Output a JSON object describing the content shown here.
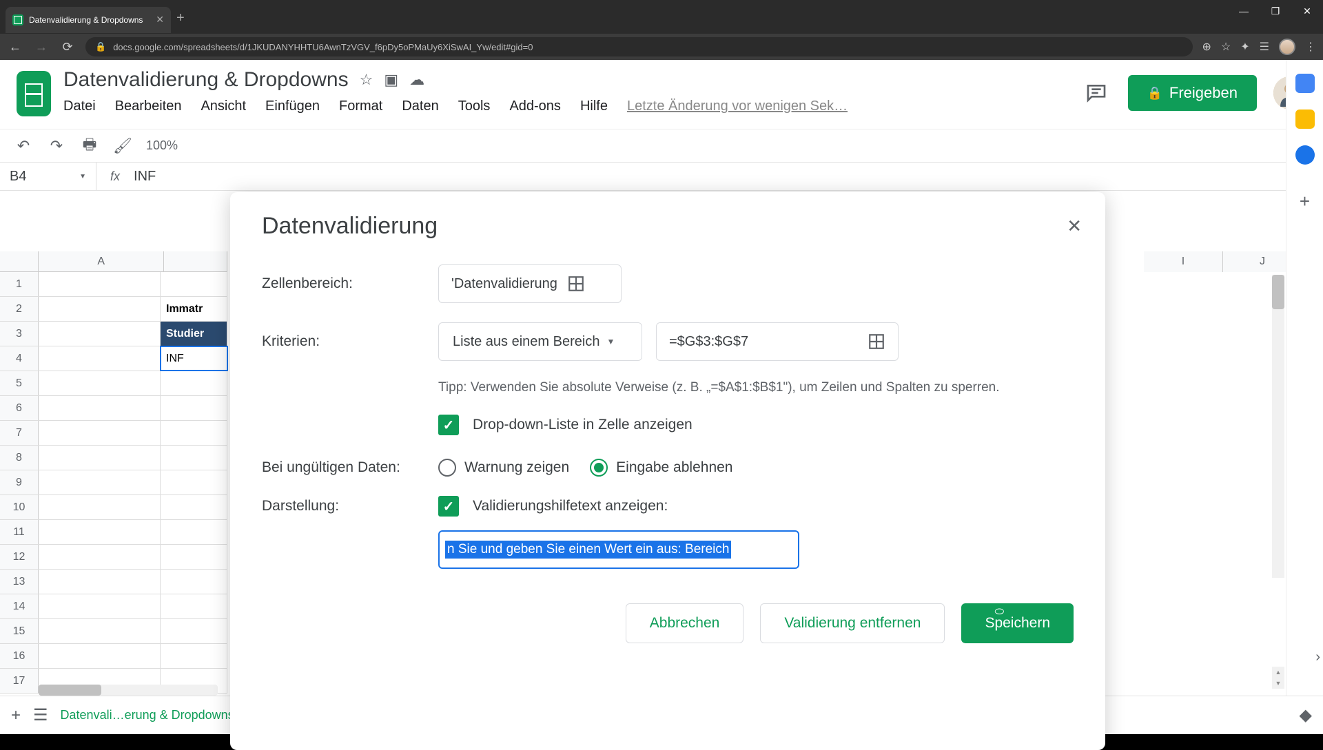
{
  "browser": {
    "tab_title": "Datenvalidierung & Dropdowns",
    "url": "docs.google.com/spreadsheets/d/1JKUDANYHHTU6AwnTzVGV_f6pDy5oPMaUy6XiSwAI_Yw/edit#gid=0"
  },
  "app": {
    "doc_title": "Datenvalidierung & Dropdowns",
    "menu": [
      "Datei",
      "Bearbeiten",
      "Ansicht",
      "Einfügen",
      "Format",
      "Daten",
      "Tools",
      "Add-ons",
      "Hilfe"
    ],
    "last_edit": "Letzte Änderung vor wenigen Sek…",
    "share_label": "Freigeben"
  },
  "toolbar": {
    "zoom": "100%"
  },
  "formula": {
    "cell_ref": "B4",
    "value": "INF"
  },
  "grid": {
    "col_headers": [
      "A"
    ],
    "right_cols": [
      "I",
      "J"
    ],
    "rows": [
      {
        "n": "1",
        "a": ""
      },
      {
        "n": "2",
        "a": "Immatr"
      },
      {
        "n": "3",
        "a": "Studier"
      },
      {
        "n": "4",
        "a": "INF"
      },
      {
        "n": "5",
        "a": ""
      },
      {
        "n": "6",
        "a": ""
      },
      {
        "n": "7",
        "a": ""
      },
      {
        "n": "8",
        "a": ""
      },
      {
        "n": "9",
        "a": ""
      },
      {
        "n": "10",
        "a": ""
      },
      {
        "n": "11",
        "a": ""
      },
      {
        "n": "12",
        "a": ""
      },
      {
        "n": "13",
        "a": ""
      },
      {
        "n": "14",
        "a": ""
      },
      {
        "n": "15",
        "a": ""
      },
      {
        "n": "16",
        "a": ""
      },
      {
        "n": "17",
        "a": ""
      }
    ]
  },
  "sheet_tab": "Datenvali…erung & Dropdowns",
  "dialog": {
    "title": "Datenvalidierung",
    "labels": {
      "range": "Zellenbereich:",
      "criteria": "Kriterien:",
      "invalid": "Bei ungültigen Daten:",
      "appearance": "Darstellung:"
    },
    "range_value": "'Datenvalidierung",
    "criteria_type": "Liste aus einem Bereich",
    "criteria_range": "=$G$3:$G$7",
    "tip": "Tipp: Verwenden Sie absolute Verweise (z. B. „=$A$1:$B$1\"), um Zeilen und Spalten zu sperren.",
    "show_dropdown": "Drop-down-Liste in Zelle anzeigen",
    "radio_warn": "Warnung zeigen",
    "radio_reject": "Eingabe ablehnen",
    "show_help": "Validierungshilfetext anzeigen:",
    "help_text": "n Sie und geben Sie einen Wert ein aus: Bereich",
    "actions": {
      "cancel": "Abbrechen",
      "remove": "Validierung entfernen",
      "save": "Speichern"
    }
  }
}
